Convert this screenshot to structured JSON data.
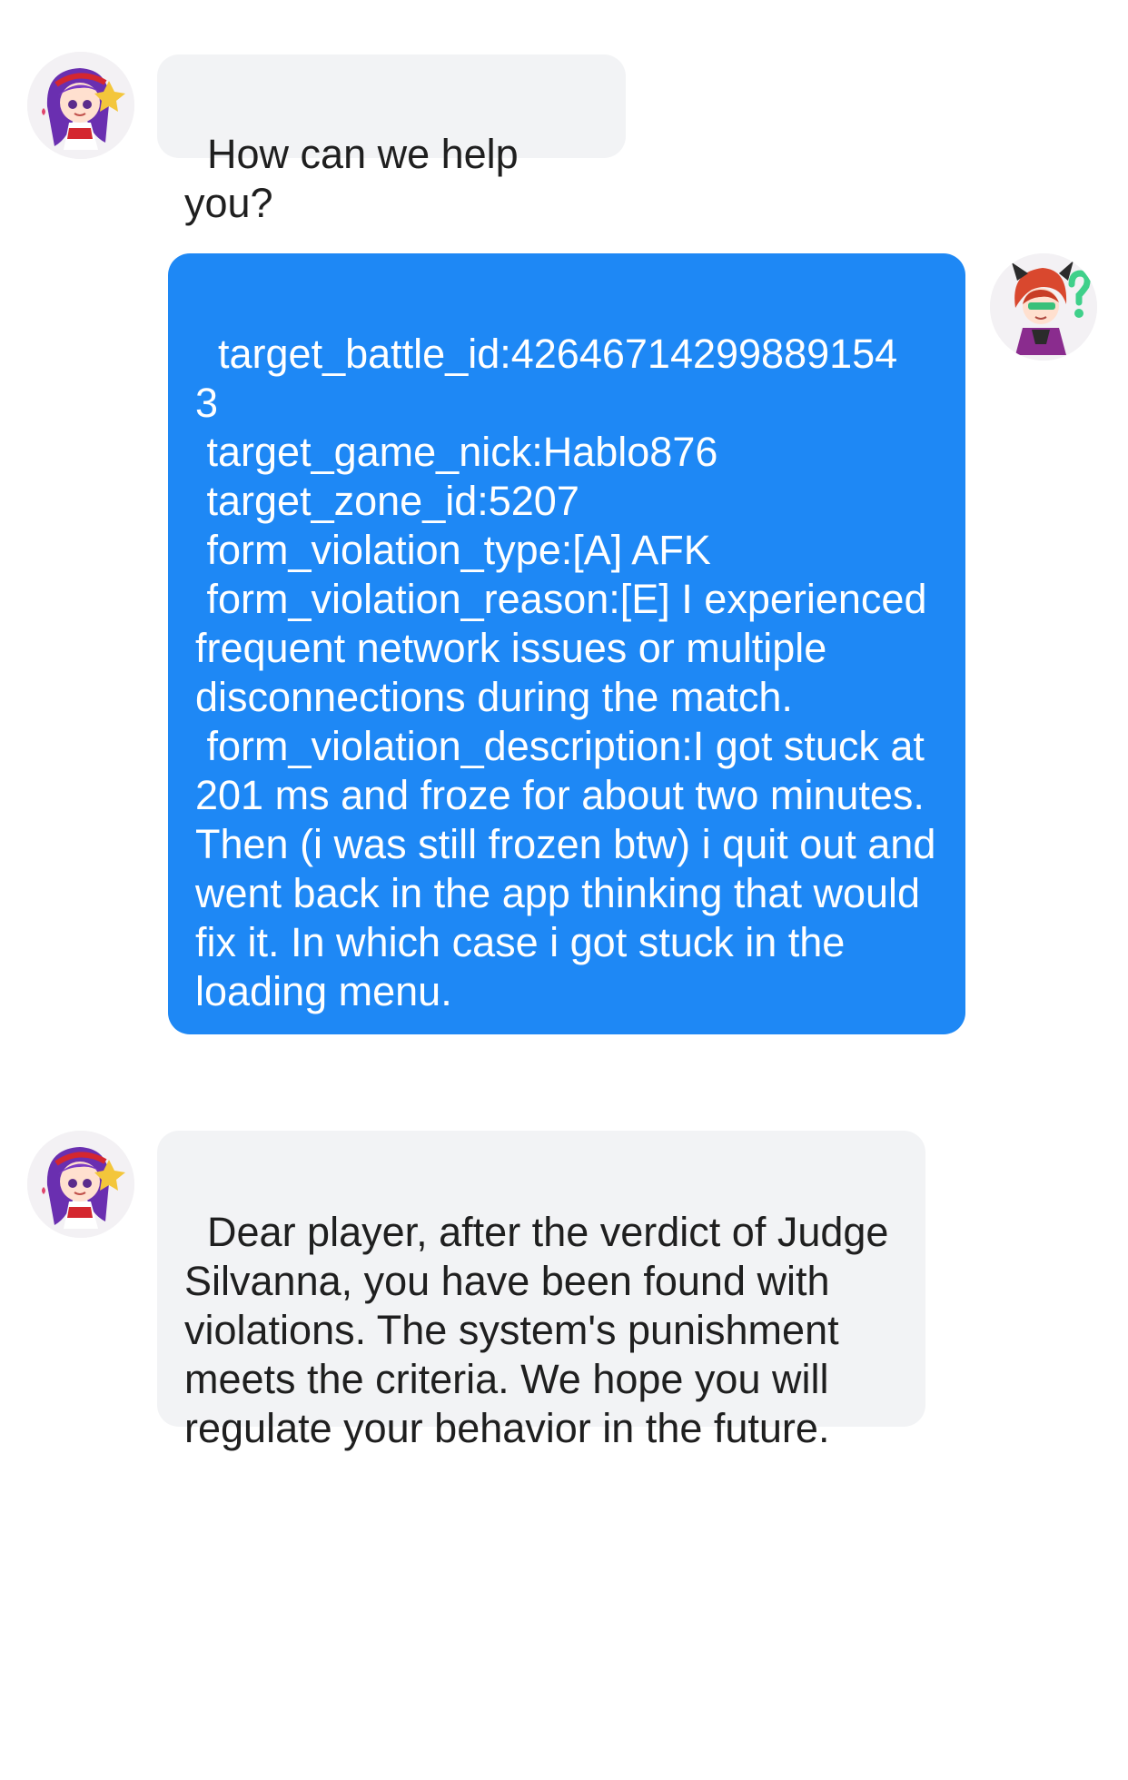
{
  "chat": {
    "messages": [
      {
        "sender": "support",
        "avatar": "support-agent-avatar",
        "text": "How can we help you?"
      },
      {
        "sender": "player",
        "avatar": "player-avatar",
        "text": "target_battle_id:42646714299889154\n3\n target_game_nick:Hablo876\n target_zone_id:5207\n form_violation_type:[A] AFK\n form_violation_reason:[E] I experienced frequent network issues or multiple disconnections during the match.\n form_violation_description:I got stuck at 201 ms and froze for about two minutes. Then (i was still frozen btw) i quit out and went back in the app thinking that would fix it. In which case i got stuck in the loading menu."
      },
      {
        "sender": "support",
        "avatar": "support-agent-avatar",
        "text": "Dear player, after the verdict of Judge Silvanna, you have been found with violations. The system's punishment meets the criteria. We hope you will regulate your behavior in the future."
      }
    ]
  },
  "colors": {
    "outgoing_bubble": "#1e88f5",
    "incoming_bubble": "#f2f3f5",
    "incoming_text": "#1f1f1f",
    "outgoing_text": "#ffffff"
  }
}
